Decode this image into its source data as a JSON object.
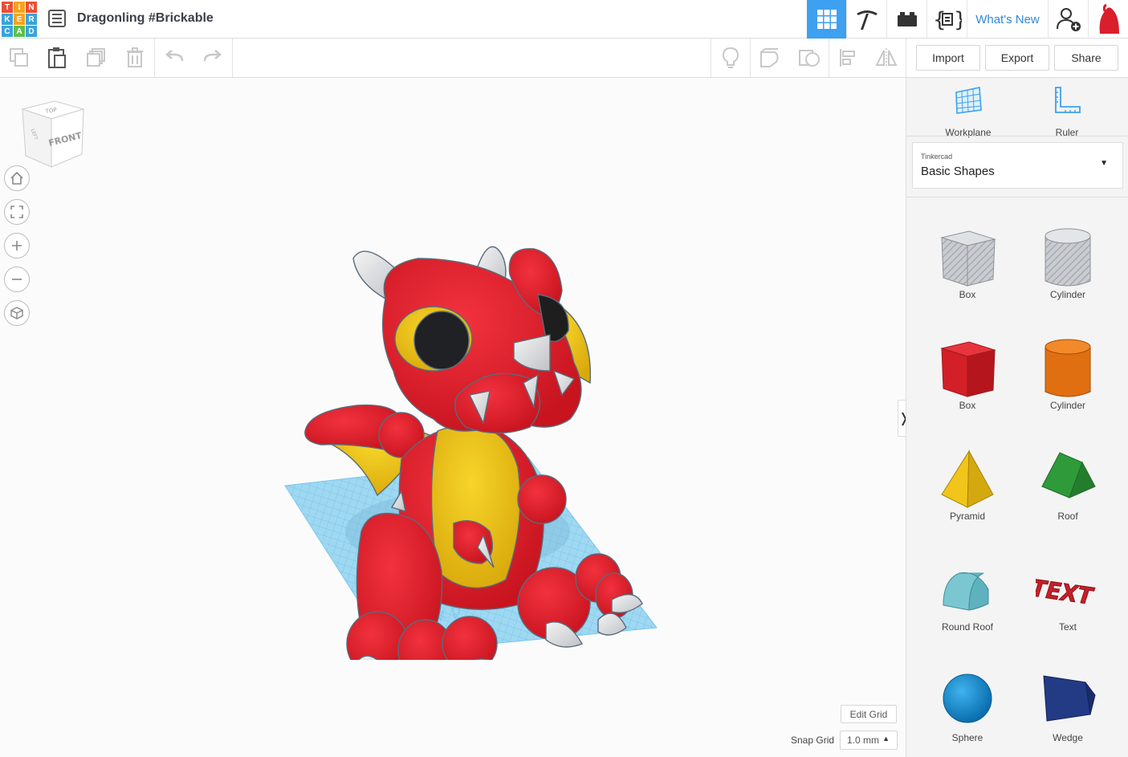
{
  "header": {
    "logo_letters": [
      "T",
      "I",
      "N",
      "K",
      "E",
      "R",
      "C",
      "A",
      "D"
    ],
    "logo_colors": [
      "#e94f37",
      "#f6a21e",
      "#e94f37",
      "#3aa3db",
      "#f6a21e",
      "#3aa3db",
      "#3aa3db",
      "#5fbf4c",
      "#3aa3db"
    ],
    "title": "Dragonling #Brickable",
    "whats_new": "What's New"
  },
  "toolbar": {
    "import_label": "Import",
    "export_label": "Export",
    "share_label": "Share"
  },
  "viewcube": {
    "top": "TOP",
    "front": "FRONT",
    "left": "LEFT"
  },
  "panel": {
    "workplane_label": "Workplane",
    "ruler_label": "Ruler",
    "library_brand": "Tinkercad",
    "library_name": "Basic Shapes",
    "shapes": [
      {
        "label": "Box",
        "icon": "box-hole-icon"
      },
      {
        "label": "Cylinder",
        "icon": "cylinder-hole-icon"
      },
      {
        "label": "Box",
        "icon": "box-icon"
      },
      {
        "label": "Cylinder",
        "icon": "cylinder-icon"
      },
      {
        "label": "Pyramid",
        "icon": "pyramid-icon"
      },
      {
        "label": "Roof",
        "icon": "roof-icon"
      },
      {
        "label": "Round Roof",
        "icon": "round-roof-icon"
      },
      {
        "label": "Text",
        "icon": "text-icon"
      },
      {
        "label": "Sphere",
        "icon": "sphere-icon"
      },
      {
        "label": "Wedge",
        "icon": "wedge-icon"
      }
    ]
  },
  "grid": {
    "edit_grid_label": "Edit Grid",
    "snap_grid_label": "Snap Grid",
    "snap_value": "1.0 mm"
  },
  "colors": {
    "accent": "#2f89d6",
    "active_tab": "#3ea0f0",
    "dragon_red": "#e52330",
    "dragon_yellow": "#f2c417",
    "horn_grey": "#d8dadd",
    "workplane": "#8fd1f0"
  }
}
